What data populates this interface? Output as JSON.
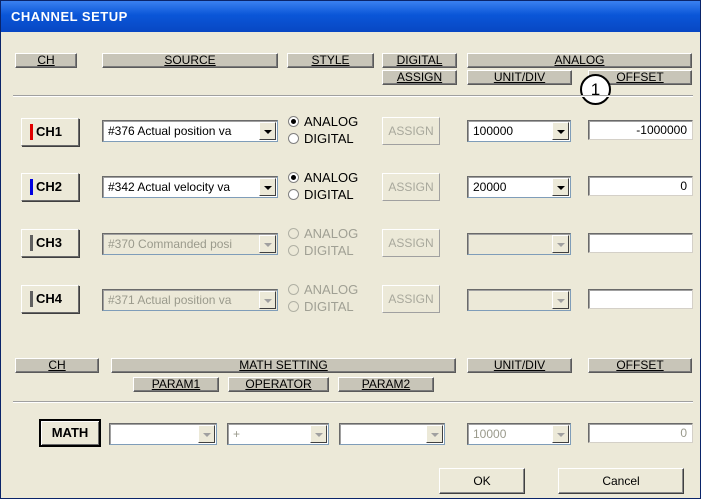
{
  "window": {
    "title": "CHANNEL SETUP"
  },
  "headers": {
    "ch": "CH",
    "source": "SOURCE",
    "style": "STYLE",
    "digital": "DIGITAL",
    "assign": "ASSIGN",
    "analog": "ANALOG",
    "unit_div": "UNIT/DIV",
    "offset": "OFFSET"
  },
  "channels": [
    {
      "label": "CH1",
      "marker_color": "#e00000",
      "source": "#376  Actual position va",
      "analog": "ANALOG",
      "digital": "DIGITAL",
      "style_selected": "ANALOG",
      "assign": "ASSIGN",
      "unit_div": "100000",
      "offset": "-1000000",
      "enabled": true
    },
    {
      "label": "CH2",
      "marker_color": "#0000e0",
      "source": "#342  Actual velocity va",
      "analog": "ANALOG",
      "digital": "DIGITAL",
      "style_selected": "ANALOG",
      "assign": "ASSIGN",
      "unit_div": "20000",
      "offset": "0",
      "enabled": true
    },
    {
      "label": "CH3",
      "marker_color": "#606060",
      "source": "#370  Commanded posi",
      "analog": "ANALOG",
      "digital": "DIGITAL",
      "style_selected": "",
      "assign": "ASSIGN",
      "unit_div": "",
      "offset": "",
      "enabled": false
    },
    {
      "label": "CH4",
      "marker_color": "#606060",
      "source": "#371  Actual position va",
      "analog": "ANALOG",
      "digital": "DIGITAL",
      "style_selected": "",
      "assign": "ASSIGN",
      "unit_div": "",
      "offset": "",
      "enabled": false
    }
  ],
  "math_headers": {
    "ch": "CH",
    "math_setting": "MATH SETTING",
    "param1": "PARAM1",
    "operator": "OPERATOR",
    "param2": "PARAM2",
    "unit_div": "UNIT/DIV",
    "offset": "OFFSET"
  },
  "math": {
    "label": "MATH",
    "param1": "",
    "operator": "+",
    "param2": "",
    "unit_div": "10000",
    "offset": "0"
  },
  "buttons": {
    "ok": "OK",
    "cancel": "Cancel"
  },
  "callout": "1"
}
